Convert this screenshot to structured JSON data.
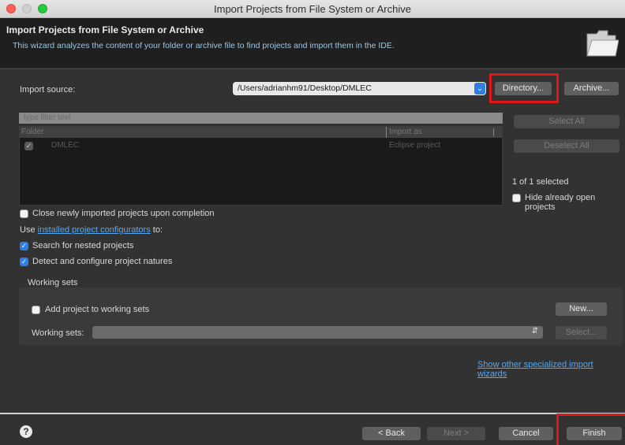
{
  "window": {
    "title": "Import Projects from File System or Archive"
  },
  "header": {
    "title": "Import Projects from File System or Archive",
    "description": "This wizard analyzes the content of your folder or archive file to find projects and import them in the IDE."
  },
  "import_source": {
    "label": "Import source:",
    "value": "/Users/adrianhm91/Desktop/DMLEC",
    "directory_button": "Directory...",
    "archive_button": "Archive..."
  },
  "filter": {
    "placeholder": "type filter text"
  },
  "table": {
    "columns": [
      "Folder",
      "Import as"
    ],
    "rows": [
      {
        "folder": "DMLEC",
        "import_as": "Eclipse project",
        "checked": true
      }
    ]
  },
  "side": {
    "select_all": "Select All",
    "deselect_all": "Deselect All",
    "selected_count": "1 of 1 selected",
    "hide_open_label": "Hide already open projects"
  },
  "options": {
    "close_newly": "Close newly imported projects upon completion",
    "use_prefix": "Use",
    "configurators_link": "installed project configurators",
    "use_suffix": "to:",
    "search_nested": "Search for nested projects",
    "detect_natures": "Detect and configure project natures"
  },
  "working_sets": {
    "title": "Working sets",
    "add_label": "Add project to working sets",
    "new_button": "New...",
    "sets_label": "Working sets:",
    "select_button": "Select..."
  },
  "specialized_link": "Show other specialized import wizards",
  "footer": {
    "back": "< Back",
    "next": "Next >",
    "cancel": "Cancel",
    "finish": "Finish"
  },
  "colors": {
    "highlight": "#e0161a",
    "link": "#59a7ec",
    "accent": "#2d7fe4"
  }
}
